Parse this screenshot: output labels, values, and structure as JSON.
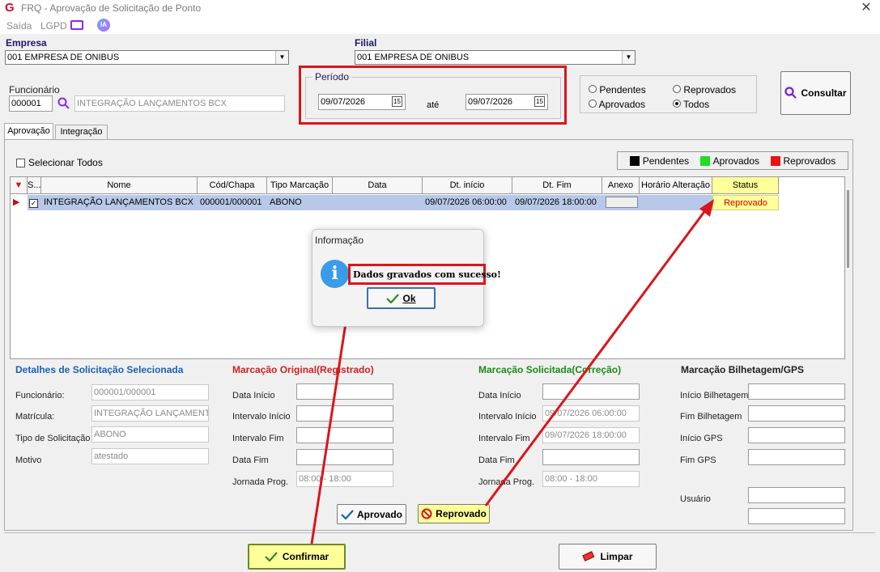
{
  "window": {
    "title": "FRQ - Aprovação de Solicitação de Ponto",
    "logo": "G"
  },
  "menu": {
    "items": [
      "Saída",
      "LGPD"
    ],
    "ia_label": "IA"
  },
  "empresa": {
    "label": "Empresa",
    "value": "001 EMPRESA DE ONIBUS"
  },
  "filial": {
    "label": "Filial",
    "value": "001 EMPRESA DE ONIBUS"
  },
  "funcionario": {
    "label": "Funcionário",
    "code": "000001",
    "name": "INTEGRAÇÃO LANÇAMENTOS BCX"
  },
  "periodo": {
    "label": "Período",
    "from": "09/07/2026",
    "sep": "até",
    "to": "09/07/2026"
  },
  "filters": {
    "pendentes": "Pendentes",
    "reprovados": "Reprovados",
    "aprovados": "Aprovados",
    "todos": "Todos",
    "selected": "Todos"
  },
  "consultar_label": "Consultar",
  "tabs": [
    "Aprovação",
    "Integração"
  ],
  "selecionar_todos": "Selecionar Todos",
  "legend": {
    "pendentes": "Pendentes",
    "aprovados": "Aprovados",
    "reprovados": "Reprovados",
    "colors": {
      "pendentes": "#000000",
      "aprovados": "#22dd22",
      "reprovados": "#ee1111"
    }
  },
  "table": {
    "columns": [
      "S...",
      "Nome",
      "Cód/Chapa",
      "Tipo Marcação",
      "Data",
      "Dt. início",
      "Dt. Fim",
      "Anexo",
      "Horário Alteração",
      "Status"
    ],
    "rows": [
      {
        "nome": "INTEGRAÇÃO LANÇAMENTOS BCX",
        "cod": "000001/000001",
        "tipo": "ABONO",
        "data": "",
        "dt_inicio": "09/07/2026 06:00:00",
        "dt_fim": "09/07/2026 18:00:00",
        "anexo": "",
        "horario": "",
        "status": "Reprovado"
      }
    ]
  },
  "dialog": {
    "title": "Informação",
    "message": "Dados gravados com sucesso!",
    "ok": "Ok"
  },
  "detalhes": {
    "title": "Detalhes de Solicitação Selecionada",
    "funcionario_label": "Funcionário:",
    "funcionario": "000001/000001",
    "matricula_label": "Matrícula:",
    "matricula": "INTEGRAÇÃO LANÇAMENTOS BCX",
    "tipo_label": "Tipo de Solicitação",
    "tipo": "ABONO",
    "motivo_label": "Motivo",
    "motivo": "atestado"
  },
  "original": {
    "title": "Marcação Original(Registrado)",
    "labels": [
      "Data Início",
      "Intervalo Início",
      "Intervalo Fim",
      "Data Fim",
      "Jornada Prog."
    ],
    "values": [
      "",
      "",
      "",
      "",
      "08:00 - 18:00"
    ]
  },
  "solicitada": {
    "title": "Marcação Solicitada(Correção)",
    "labels": [
      "Data Início",
      "Intervalo Início",
      "Intervalo Fim",
      "Data Fim",
      "Jornada Prog."
    ],
    "values": [
      "",
      "09/07/2026 06:00:00",
      "09/07/2026 18:00:00",
      "",
      "08:00 - 18:00"
    ]
  },
  "bilhetagem": {
    "title": "Marcação Bilhetagem/GPS",
    "labels": [
      "Início Bilhetagem",
      "Fim Bilhetagem",
      "Início GPS",
      "Fim GPS",
      "Usuário"
    ]
  },
  "buttons": {
    "aprovado": "Aprovado",
    "reprovado": "Reprovado",
    "confirmar": "Confirmar",
    "limpar": "Limpar"
  },
  "colors": {
    "row_selected": "#b8c8e8",
    "status_bg": "#ffff99",
    "status_text": "#cc0000",
    "annotation_red": "#d9161c",
    "original_title": "#cc2222",
    "solicitada_title": "#1a8a1a",
    "detalhes_title": "#1a5fb4"
  }
}
